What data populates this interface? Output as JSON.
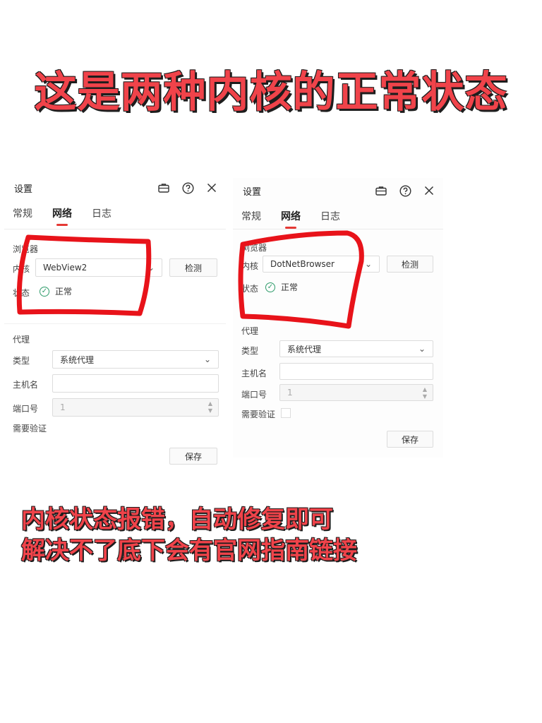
{
  "headline": "这是两种内核的正常状态",
  "caption": {
    "line1": "内核状态报错，自动修复即可",
    "line2": "解决不了底下会有官网指南链接"
  },
  "panels": [
    {
      "title": "设置",
      "tabs": [
        "常规",
        "网络",
        "日志"
      ],
      "active_tab": "网络",
      "browser_section": "浏览器",
      "engine_label": "内核",
      "engine_value": "WebView2",
      "detect_button": "检测",
      "status_label": "状态",
      "status_value": "正常",
      "proxy_section": "代理",
      "type_label": "类型",
      "type_value": "系统代理",
      "host_label": "主机名",
      "host_value": "",
      "port_label": "端口号",
      "port_value": "1",
      "auth_label": "需要验证",
      "save_button": "保存"
    },
    {
      "title": "设置",
      "tabs": [
        "常规",
        "网络",
        "日志"
      ],
      "active_tab": "网络",
      "browser_section": "浏览器",
      "engine_label": "内核",
      "engine_value": "DotNetBrowser",
      "detect_button": "检测",
      "status_label": "状态",
      "status_value": "正常",
      "proxy_section": "代理",
      "type_label": "类型",
      "type_value": "系统代理",
      "host_label": "主机名",
      "host_value": "",
      "port_label": "端口号",
      "port_value": "1",
      "auth_label": "需要验证",
      "save_button": "保存"
    }
  ],
  "icons": [
    "briefcase-icon",
    "help-icon",
    "close-icon",
    "chevron-down-icon",
    "check-circle-icon"
  ],
  "colors": {
    "accent": "#e53935",
    "annotation": "#e8131a",
    "headline": "#f0434a",
    "ok": "#2e9b6a"
  }
}
